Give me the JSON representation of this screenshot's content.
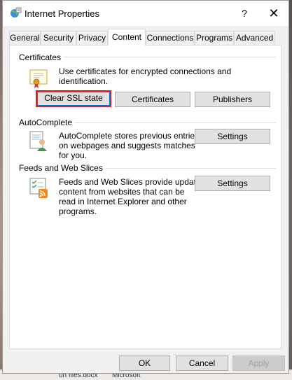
{
  "window": {
    "title": "Internet Properties",
    "help_label": "?",
    "close_label": "✕"
  },
  "tabs": [
    {
      "label": "General"
    },
    {
      "label": "Security"
    },
    {
      "label": "Privacy"
    },
    {
      "label": "Content",
      "active": true
    },
    {
      "label": "Connections"
    },
    {
      "label": "Programs"
    },
    {
      "label": "Advanced"
    }
  ],
  "certificates": {
    "heading": "Certificates",
    "description": "Use certificates for encrypted connections and identification.",
    "clear_ssl_label": "Clear SSL state",
    "certificates_label": "Certificates",
    "publishers_label": "Publishers"
  },
  "autocomplete": {
    "heading": "AutoComplete",
    "description_lines": [
      "AutoComplete stores previous entries",
      "on webpages and suggests matches",
      "for you."
    ],
    "settings_label": "Settings"
  },
  "feeds": {
    "heading": "Feeds and Web Slices",
    "description_lines": [
      "Feeds and Web Slices provide updated",
      "content from websites that can be",
      "read in Internet Explorer and other",
      "programs."
    ],
    "settings_label": "Settings"
  },
  "footer": {
    "ok_label": "OK",
    "cancel_label": "Cancel",
    "apply_label": "Apply"
  },
  "desktop": {
    "taskbar_text_1": "un files.docx",
    "taskbar_text_2": "Microsoft"
  },
  "colors": {
    "focus_outline": "#e02020",
    "panel_bg": "#ffffff",
    "window_bg": "#f0f0f0"
  }
}
